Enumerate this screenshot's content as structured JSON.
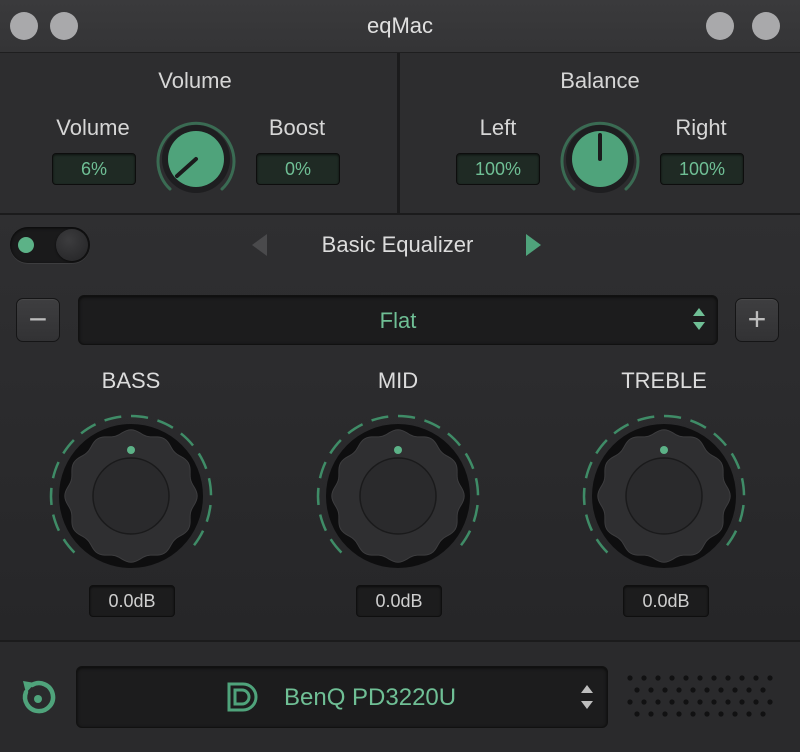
{
  "window": {
    "title": "eqMac"
  },
  "volume_panel": {
    "title": "Volume",
    "volume_label": "Volume",
    "volume_value": "6%",
    "boost_label": "Boost",
    "boost_value": "0%"
  },
  "balance_panel": {
    "title": "Balance",
    "left_label": "Left",
    "left_value": "100%",
    "right_label": "Right",
    "right_value": "100%"
  },
  "equalizer": {
    "enabled": true,
    "name": "Basic Equalizer",
    "preset": "Flat",
    "minus_label": "−",
    "plus_label": "+",
    "bands": [
      {
        "label": "BASS",
        "value": "0.0dB"
      },
      {
        "label": "MID",
        "value": "0.0dB"
      },
      {
        "label": "TREBLE",
        "value": "0.0dB"
      }
    ]
  },
  "output": {
    "device_name": "BenQ PD3220U"
  },
  "colors": {
    "accent": "#6fbf95",
    "knob_green": "#4fa37b",
    "background": "#2b2b2d"
  }
}
